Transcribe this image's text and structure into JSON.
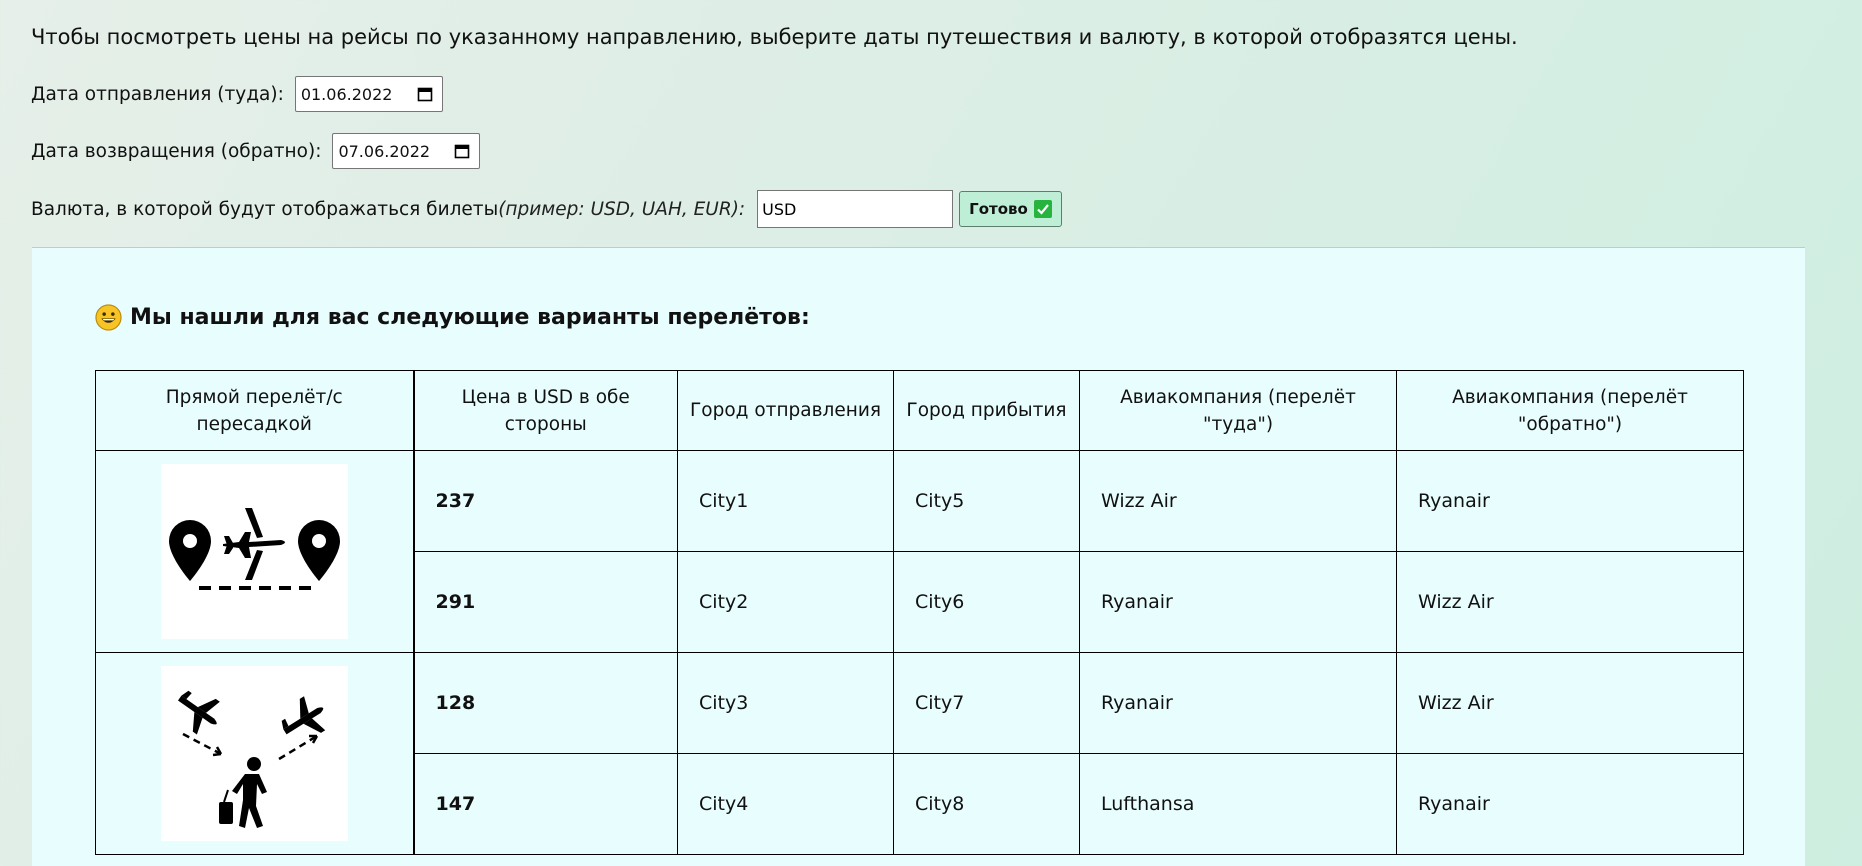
{
  "intro": "Чтобы посмотреть цены на рейсы по указанному направлению, выберите даты путешествия и валюту, в которой отобразятся цены.",
  "form": {
    "depart_label": "Дата отправления (туда):",
    "depart_value": "01.06.2022",
    "return_label": "Дата возвращения (обратно):",
    "return_value": "07.06.2022",
    "currency_label": "Валюта, в которой будут отображаться билеты",
    "currency_hint": "(пример: USD, UAH, EUR):",
    "currency_value": "USD",
    "submit_label": "Готово"
  },
  "results": {
    "title": "Мы нашли для вас следующие варианты перелётов:",
    "columns": [
      "Прямой перелёт/с пересадкой",
      "Цена в USD в обе стороны",
      "Город отправления",
      "Город прибытия",
      "Авиакомпания (перелёт \"туда\")",
      "Авиакомпания (перелёт \"обратно\")"
    ],
    "groups": [
      {
        "type_icon": "direct-flight-icon",
        "rows": [
          {
            "price": "237",
            "from": "City1",
            "to": "City5",
            "airline_out": "Wizz Air",
            "airline_back": "Ryanair"
          },
          {
            "price": "291",
            "from": "City2",
            "to": "City6",
            "airline_out": "Ryanair",
            "airline_back": "Wizz Air"
          }
        ]
      },
      {
        "type_icon": "transfer-flight-icon",
        "rows": [
          {
            "price": "128",
            "from": "City3",
            "to": "City7",
            "airline_out": "Ryanair",
            "airline_back": "Wizz Air"
          },
          {
            "price": "147",
            "from": "City4",
            "to": "City8",
            "airline_out": "Lufthansa",
            "airline_back": "Ryanair"
          }
        ]
      }
    ]
  },
  "colors": {
    "panel_bg": "#e8fdfd",
    "button_bg": "#bfeed6",
    "check_green": "#26b43f",
    "emoji_yellow": "#f7c325"
  }
}
